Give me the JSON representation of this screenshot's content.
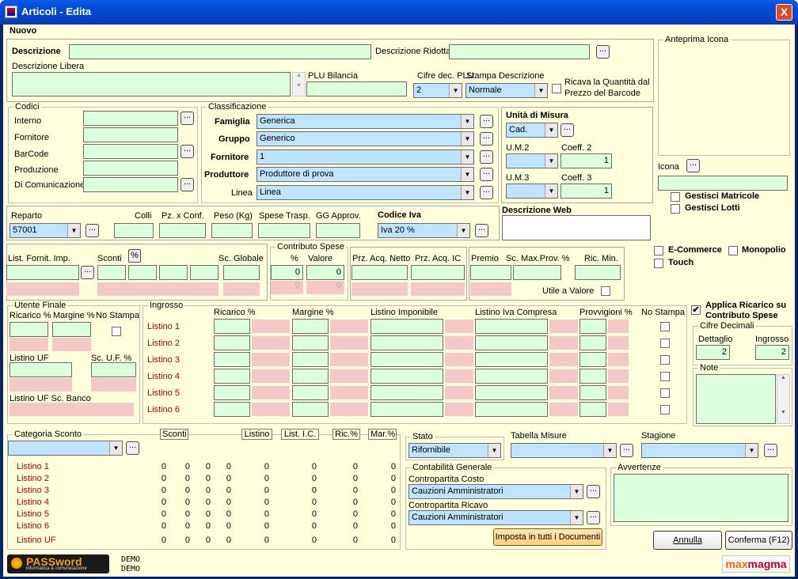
{
  "window": {
    "title": "Articoli - Edita",
    "close_glyph": "X"
  },
  "header": {
    "mode": "Nuovo"
  },
  "descr": {
    "descrizione": "Descrizione",
    "descrizione_ridotta": "Descrizione Ridotta",
    "descrizione_libera": "Descrizione Libera",
    "plu_bilancia": "PLU Bilancia",
    "cifre_dec_plu": "Cifre dec. PLU",
    "cifre_dec_plu_value": "2",
    "stampa_descrizione": "Stampa Descrizione",
    "stampa_descrizione_value": "Normale",
    "ricava_line1": "Ricava la Quantità dal",
    "ricava_line2": "Prezzo del Barcode"
  },
  "anteprima": {
    "title": "Anteprima Icona",
    "icona": "Icona",
    "gestisci_matricole": "Gestisci Matricole",
    "gestisci_lotti": "Gestisci Lotti"
  },
  "codici": {
    "title": "Codici",
    "interno": "Interno",
    "fornitore": "Fornitore",
    "barcode": "BarCode",
    "produzione": "Produzione",
    "di_comunicazione": "Di Comunicazione"
  },
  "classificazione": {
    "title": "Classificazione",
    "famiglia": "Famiglia",
    "famiglia_value": "Generica",
    "gruppo": "Gruppo",
    "gruppo_value": "Generico",
    "fornitore": "Fornitore",
    "fornitore_value": "1",
    "produttore": "Produttore",
    "produttore_value": "Produttore di prova",
    "linea": "Linea",
    "linea_value": "Linea"
  },
  "um": {
    "title": "Unità di Misura",
    "um_value": "Cad.",
    "um2": "U.M.2",
    "coeff2": "Coeff. 2",
    "coeff2_value": "1",
    "um3": "U.M.3",
    "coeff3": "Coeff. 3",
    "coeff3_value": "1"
  },
  "reparto": {
    "reparto": "Reparto",
    "reparto_value": "57001",
    "colli": "Colli",
    "pz_conf": "Pz. x Conf.",
    "peso": "Peso (Kg)",
    "spese_trasp": "Spese Trasp.",
    "gg_approv": "GG Approv.",
    "codice_iva": "Codice Iva",
    "codice_iva_value": "Iva 20 %"
  },
  "web": {
    "descrizione_web": "Descrizione Web",
    "ecommerce": "E-Commerce",
    "monopolio": "Monopolio",
    "touch": "Touch"
  },
  "listino": {
    "list_fornit_imp": "List. Fornit. Imp.",
    "sconti": "Sconti",
    "pct_btn": "%",
    "sc_globale": "Sc. Globale",
    "contributo_spese": "Contributo Spese",
    "pct": "%",
    "valore": "Valore",
    "contrib_pct_value": "0",
    "contrib_valore_value": "0",
    "contrib_pct_sub": "0",
    "contrib_valore_sub": "0",
    "prz_acq_netto": "Prz. Acq. Netto",
    "prz_acq_ic": "Prz. Acq. IC",
    "premio": "Premio",
    "sc_max_prov": "Sc. Max.Prov. %",
    "ric_min": "Ric. Min.",
    "utile_a_valore": "Utile a Valore"
  },
  "utente_finale": {
    "title": "Utente Finale",
    "ricarico": "Ricarico %",
    "margine": "Margine %",
    "no_stampa": "No Stampa",
    "listino_uf": "Listino UF",
    "sc_uf": "Sc. U.F. %",
    "listino_uf_sc_banco": "Listino UF Sc. Banco"
  },
  "ingrosso": {
    "title": "Ingrosso",
    "ricarico": "Ricarico %",
    "margine": "Margine %",
    "listino_imponibile": "Listino Imponibile",
    "listino_iva_compresa": "Listino Iva Compresa",
    "provvigioni": "Provvigioni %",
    "no_stampa": "No Stampa",
    "rows": [
      "Listino 1",
      "Listino 2",
      "Listino 3",
      "Listino 4",
      "Listino 5",
      "Listino 6"
    ]
  },
  "applica": {
    "line1": "Applica Ricarico su",
    "line2": "Contributo Spese",
    "checked_glyph": "✔"
  },
  "cifre_decimali": {
    "title": "Cifre Decimali",
    "dettaglio": "Dettaglio",
    "dettaglio_value": "2",
    "ingrosso": "Ingrosso",
    "ingrosso_value": "2"
  },
  "note": {
    "title": "Note"
  },
  "categoria_sconto": {
    "title": "Categoria Sconto",
    "sconti": "Sconti",
    "listino": "Listino",
    "list_ic": "List. I.C.",
    "ric": "Ric.%",
    "mar": "Mar.%",
    "rows": [
      {
        "name": "Listino 1",
        "s1": "0",
        "s2": "0",
        "s3": "0",
        "s4": "0",
        "listino": "0",
        "list_ic": "0",
        "ric": "0",
        "mar": "0"
      },
      {
        "name": "Listino 2",
        "s1": "0",
        "s2": "0",
        "s3": "0",
        "s4": "0",
        "listino": "0",
        "list_ic": "0",
        "ric": "0",
        "mar": "0"
      },
      {
        "name": "Listino 3",
        "s1": "0",
        "s2": "0",
        "s3": "0",
        "s4": "0",
        "listino": "0",
        "list_ic": "0",
        "ric": "0",
        "mar": "0"
      },
      {
        "name": "Listino 4",
        "s1": "0",
        "s2": "0",
        "s3": "0",
        "s4": "0",
        "listino": "0",
        "list_ic": "0",
        "ric": "0",
        "mar": "0"
      },
      {
        "name": "Listino 5",
        "s1": "0",
        "s2": "0",
        "s3": "0",
        "s4": "0",
        "listino": "0",
        "list_ic": "0",
        "ric": "0",
        "mar": "0"
      },
      {
        "name": "Listino 6",
        "s1": "0",
        "s2": "0",
        "s3": "0",
        "s4": "0",
        "listino": "0",
        "list_ic": "0",
        "ric": "0",
        "mar": "0"
      },
      {
        "name": "Listino UF",
        "s1": "0",
        "s2": "0",
        "s3": "0",
        "s4": "0",
        "listino": "0",
        "list_ic": "0",
        "ric": "0",
        "mar": "0"
      }
    ]
  },
  "stato": {
    "title": "Stato",
    "value": "Rifornibile",
    "tabella_misure": "Tabella Misure",
    "stagione": "Stagione"
  },
  "contabilita": {
    "title": "Contabilità Generale",
    "contropartita_costo": "Contropartita Costo",
    "costo_value": "Cauzioni Amministratori",
    "contropartita_ricavo": "Contropartita Ricavo",
    "ricavo_value": "Cauzioni Amministratori",
    "imposta": "Imposta in tutti i Documenti"
  },
  "avvertenze": {
    "title": "Avvertenze"
  },
  "footer": {
    "logo_main": "PASSword",
    "logo_sub": "informatica & comunicazione",
    "demo1": "DEMO",
    "demo2": "DEMO",
    "annulla": "Annulla",
    "conferma": "Conferma (F12)",
    "brand_max": "max",
    "brand_magma": "magma"
  },
  "glyphs": {
    "dots": "...",
    "arrow_down": "▼",
    "arrow_up": "▲"
  },
  "colors": {
    "field_green": "#dcffdc",
    "combo_blue": "#bee4ff",
    "panel_yellow": "#ffffdb",
    "pink": "#f5c8c8",
    "title_blue": "#0249d4"
  }
}
